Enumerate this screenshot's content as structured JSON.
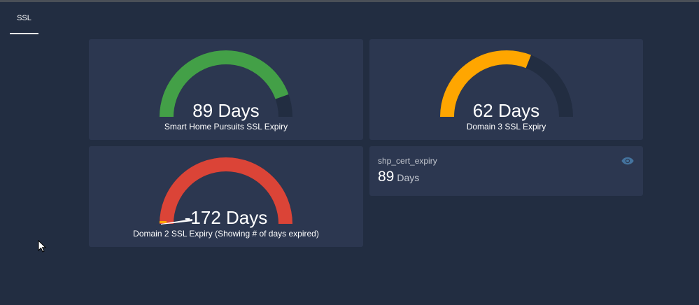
{
  "tabs": [
    {
      "label": "SSL",
      "active": true
    }
  ],
  "gauges": [
    {
      "value_text": "89 Days",
      "label": "Smart Home Pursuits SSL Expiry",
      "value": 89,
      "min": 0,
      "max": 100,
      "color": "#43a047",
      "track_color": "#222d41"
    },
    {
      "value_text": "62 Days",
      "label": "Domain 3 SSL Expiry",
      "value": 62,
      "min": 0,
      "max": 100,
      "color": "#ffa600",
      "track_color": "#222d41"
    },
    {
      "value_text": "-172 Days",
      "label": "Domain 2 SSL Expiry (Showing # of days expired)",
      "value": -172,
      "min": 0,
      "max": 100,
      "color": "#db4437",
      "track_color": "#222d41"
    }
  ],
  "sensor_card": {
    "name": "shp_cert_expiry",
    "value": "89",
    "unit": "Days",
    "icon": "eye-icon"
  },
  "colors": {
    "background": "#222d41",
    "card": "#2c3750",
    "accent": "#44739e"
  }
}
